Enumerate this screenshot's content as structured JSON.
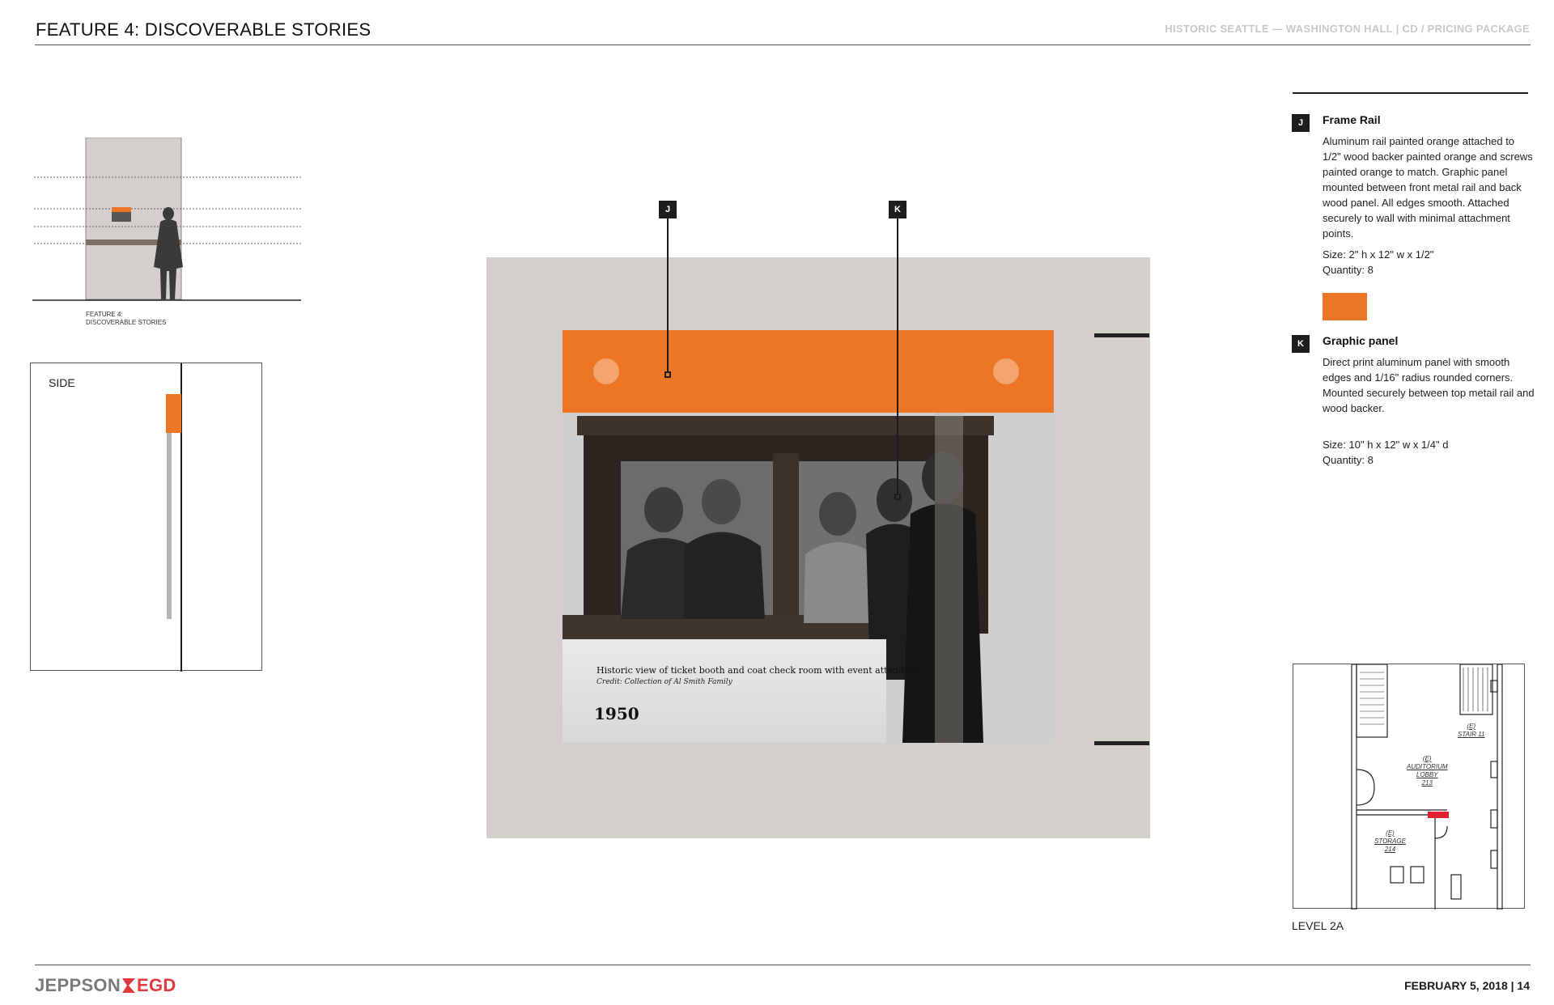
{
  "header": {
    "page_title": "FEATURE 4: DISCOVERABLE STORIES",
    "project_title": "HISTORIC SEATTLE — WASHINGTON HALL | CD / PRICING PACKAGE"
  },
  "elevation": {
    "caption_line1": "FEATURE 4:",
    "caption_line2": "DISCOVERABLE STORIES"
  },
  "side_view": {
    "label": "SIDE"
  },
  "main_panel": {
    "photo_caption": "Historic view of ticket booth and coat check room with event attendees.",
    "photo_credit": "Credit: Collection of Al Smith Family",
    "year": "1950",
    "callouts": [
      "J",
      "K"
    ]
  },
  "specs": [
    {
      "tag": "J",
      "title": "Frame Rail",
      "body": "Aluminum rail painted orange attached to 1/2\" wood backer painted orange and screws painted orange to match. Graphic panel mounted between front metal rail and back wood panel. All edges smooth. Attached securely to wall with minimal attachment points.",
      "size": "Size: 2\" h x 12\" w x 1/2\"",
      "quantity": "Quantity: 8"
    },
    {
      "tag": "K",
      "title": "Graphic panel",
      "body": "Direct print aluminum panel with smooth edges and 1/16\" radius rounded corners. Mounted securely between top metail rail and wood backer.",
      "size": "Size: 10\" h x 12\" w x 1/4\" d",
      "quantity": "Quantity: 8"
    }
  ],
  "floor_plan": {
    "label": "LEVEL 2A",
    "rooms": [
      {
        "name": "(E)",
        "sub": "STAIR 11"
      },
      {
        "name": "(E)",
        "sub": "AUDITORIUM",
        "sub2": "LOBBY",
        "num": "213"
      },
      {
        "name": "(E)",
        "sub": "STORAGE",
        "num": "214"
      }
    ]
  },
  "footer": {
    "logo_left": "JEPPSON",
    "logo_right": "EGD",
    "date_page": "FEBRUARY 5, 2018 | 14"
  },
  "colors": {
    "accent_orange": "#ec7625",
    "panel_gray": "#d3cfcb",
    "logo_red": "#e03a3e",
    "plan_marker_red": "#e0202e"
  }
}
